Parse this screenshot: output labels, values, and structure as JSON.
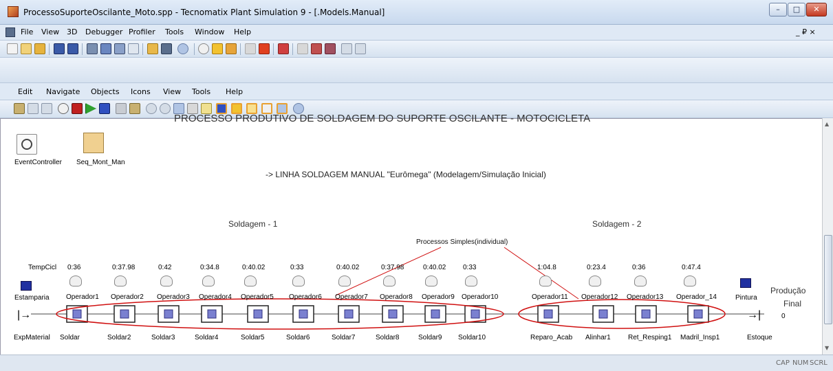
{
  "window": {
    "title": "ProcessoSuporteOscilante_Moto.spp - Tecnomatix Plant Simulation 9 - [.Models.Manual]",
    "minimize": "–",
    "maximize": "□",
    "close": "✕"
  },
  "menubar": {
    "items": [
      "File",
      "View",
      "3D",
      "Debugger",
      "Profiler",
      "Tools",
      "Window",
      "Help"
    ],
    "mdi_controls": "_ ₽ ×"
  },
  "menubar2": {
    "items": [
      "Edit",
      "Navigate",
      "Objects",
      "Icons",
      "View",
      "Tools",
      "Help"
    ]
  },
  "model": {
    "title": "PROCESSO PRODUTIVO DE SOLDAGEM DO SUPORTE OSCILANTE - MOTOCICLETA",
    "subtitle": "-> LINHA SOLDAGEM MANUAL \"Eurômega\"  (Modelagem/Simulação Inicial)",
    "event_controller": "EventController",
    "seq_table": "Seq_Mont_Man",
    "section1": "Soldagem - 1",
    "section2": "Soldagem - 2",
    "annotation": "Processos Simples(individual)",
    "tempcicl_label": "TempCicl",
    "source_name": "Estamparia",
    "source_station": "ExpMaterial",
    "sink_name": "Pintura",
    "sink_station": "Estoque",
    "producao_label": "Produção",
    "final_label": "Final",
    "producao_value": "0",
    "stations1": [
      {
        "time": "0:36",
        "operator": "Operador1",
        "station": "Soldar"
      },
      {
        "time": "0:37.98",
        "operator": "Operador2",
        "station": "Soldar2"
      },
      {
        "time": "0:42",
        "operator": "Operador3",
        "station": "Soldar3"
      },
      {
        "time": "0:34.8",
        "operator": "Operador4",
        "station": "Soldar4"
      },
      {
        "time": "0:40.02",
        "operator": "Operador5",
        "station": "Soldar5"
      },
      {
        "time": "0:33",
        "operator": "Operador6",
        "station": "Soldar6"
      },
      {
        "time": "0:40.02",
        "operator": "Operador7",
        "station": "Soldar7"
      },
      {
        "time": "0:37.98",
        "operator": "Operador8",
        "station": "Soldar8"
      },
      {
        "time": "0:40.02",
        "operator": "Operador9",
        "station": "Soldar9"
      },
      {
        "time": "0:33",
        "operator": "Operador10",
        "station": "Soldar10"
      }
    ],
    "stations2": [
      {
        "time": "1:04.8",
        "operator": "Operador11",
        "station": "Reparo_Acab"
      },
      {
        "time": "0:23.4",
        "operator": "Operador12",
        "station": "Alinhar1"
      },
      {
        "time": "0:36",
        "operator": "Operador13",
        "station": "Ret_Resping1"
      },
      {
        "time": "0:47.4",
        "operator": "Operador_14",
        "station": "Madril_Insp1"
      }
    ]
  },
  "status": {
    "cap": "CAP",
    "num": "NUM",
    "scrl": "SCRL"
  }
}
